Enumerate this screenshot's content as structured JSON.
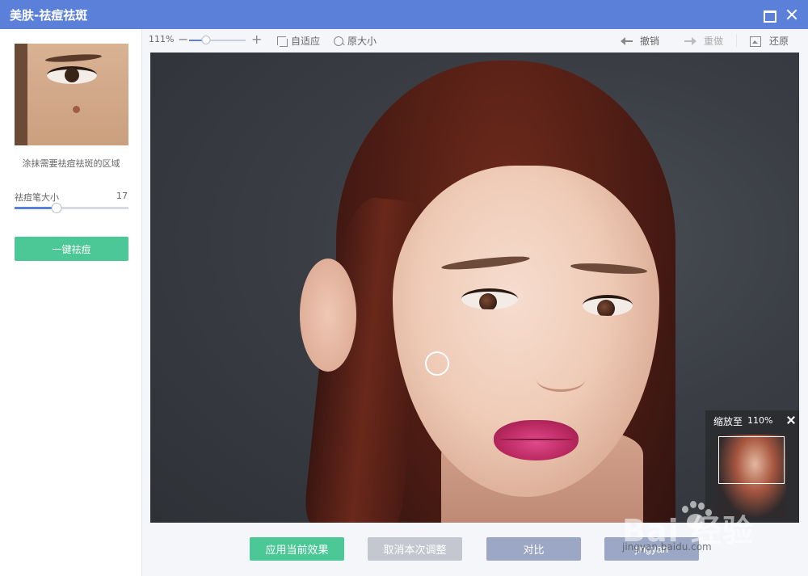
{
  "window": {
    "title": "美肤-祛痘祛斑",
    "maximize_icon": "maximize-icon",
    "close_icon": "close-icon"
  },
  "left_panel": {
    "hint": "涂抹需要祛痘祛斑的区域",
    "brush_label": "祛痘笔大小",
    "brush_size": "17",
    "brush_size_fraction": 0.37,
    "one_click_button": "一键祛痘"
  },
  "toolbar": {
    "zoom_percent": "111%",
    "zoom_fraction": 0.3,
    "fit_label": "自适应",
    "original_size_label": "原大小",
    "undo_label": "撤销",
    "redo_label": "重做",
    "restore_label": "还原"
  },
  "navigator": {
    "label": "缩放至",
    "value": "110%"
  },
  "actions": {
    "apply": "应用当前效果",
    "cancel": "取消本次调整",
    "compare": "对比",
    "done": "jingyan"
  },
  "watermark": {
    "logo": "Bai 经验",
    "url": "jingyan.baidu.com"
  },
  "colors": {
    "titlebar": "#5b80d9",
    "primary_green": "#4cc796",
    "muted_blue": "#9ba7c4",
    "disabled_gray": "#c4c7cf"
  }
}
